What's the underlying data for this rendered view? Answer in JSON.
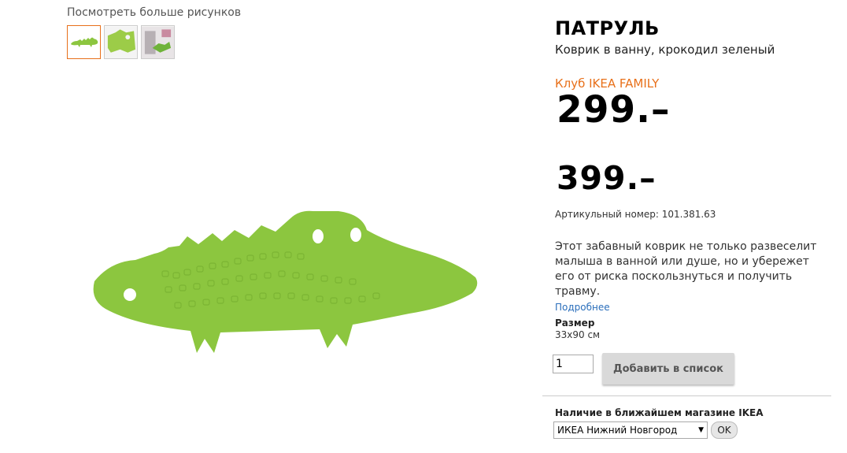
{
  "gallery": {
    "more_pictures_label": "Посмотреть больше рисунков"
  },
  "product": {
    "name": "ПАТРУЛЬ",
    "description": "Коврик в ванну, крокодил зеленый",
    "family_label": "Клуб IKEA FAMILY",
    "family_price": "299.–",
    "regular_price": "399.–",
    "article": "Артикульный номер: 101.381.63",
    "long_description": "Этот забавный коврик не только развеселит малыша в ванной или душе, но и убережет его от риска поскользнуться и получить травму.",
    "more_link": "Подробнее",
    "size_label": "Размер",
    "size_value": "33х90 см"
  },
  "cart": {
    "quantity": "1",
    "add_button": "Добавить в список"
  },
  "availability": {
    "label": "Наличие в ближайшем магазине IKEA",
    "selected_store": "ИКЕА Нижний Новгород",
    "ok_button": "OK"
  },
  "colors": {
    "accent": "#e8701a",
    "link": "#2a6ebb",
    "crocodile_green": "#8cc63f"
  }
}
